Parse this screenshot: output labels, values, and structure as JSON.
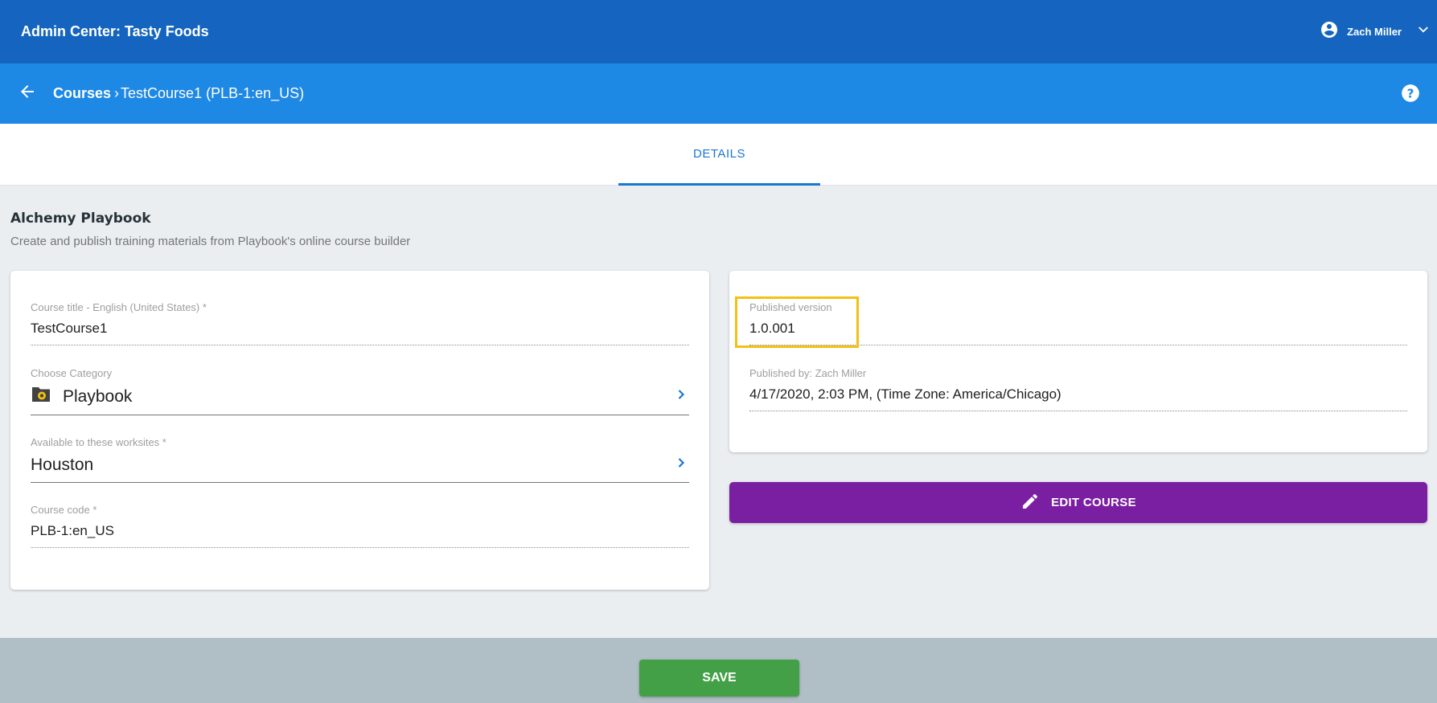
{
  "header": {
    "app_title": "Admin Center: Tasty Foods",
    "user_name": "Zach Miller"
  },
  "subheader": {
    "crumb_root": "Courses",
    "crumb_sep": "›",
    "crumb_current": "TestCourse1 (PLB-1:en_US)"
  },
  "tabs": [
    {
      "label": "DETAILS",
      "active": true
    }
  ],
  "section": {
    "title": "Alchemy Playbook",
    "description": "Create and publish training materials from Playbook's online course builder"
  },
  "course_form": {
    "title_label": "Course title - English (United States) *",
    "title_value": "TestCourse1",
    "category_label": "Choose Category",
    "category_value": "Playbook",
    "worksites_label": "Available to these worksites *",
    "worksites_value": "Houston",
    "code_label": "Course code *",
    "code_value": "PLB-1:en_US"
  },
  "publish_info": {
    "version_label": "Published version",
    "version_value": "1.0.001",
    "published_by_label": "Published by: Zach Miller",
    "published_at": "4/17/2020, 2:03 PM, (Time Zone: America/Chicago)"
  },
  "actions": {
    "edit_label": "EDIT COURSE",
    "save_label": "SAVE"
  },
  "colors": {
    "topbar": "#1565c0",
    "subbar": "#1e88e5",
    "edit_button": "#7b1fa2",
    "save_button": "#43a047",
    "highlight": "#f2c113"
  },
  "icons": [
    "account-circle-icon",
    "chevron-down-icon",
    "arrow-back-icon",
    "help-icon",
    "category-folder-icon",
    "chevron-right-icon",
    "pencil-icon"
  ]
}
